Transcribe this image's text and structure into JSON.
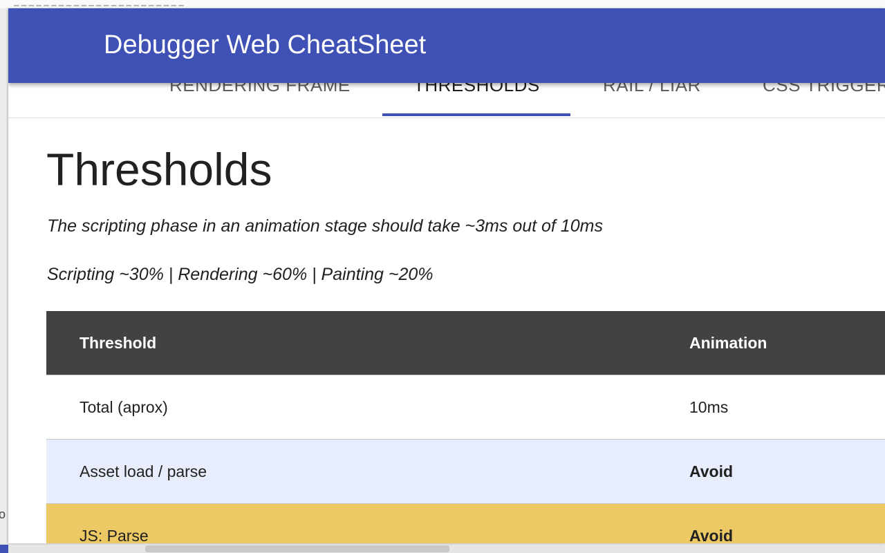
{
  "backdrop": {
    "url_fragment": "_ _ _ _ _ _ _ _ _ _ _ _ _ _ _ _ _ _ _ _ _ _ _",
    "left_edge_char": "o"
  },
  "header": {
    "title": "Debugger Web CheatSheet",
    "background": "#3f51b5"
  },
  "tabs": [
    {
      "label": "RENDERING FRAME",
      "active": false
    },
    {
      "label": "THRESHOLDS",
      "active": true
    },
    {
      "label": "RAIL / LIAR",
      "active": false
    },
    {
      "label": "CSS TRIGGER",
      "active": false
    }
  ],
  "page": {
    "title": "Thresholds",
    "intro": "The scripting phase in an animation stage should take ~3ms out of 10ms",
    "split": "Scripting ~30% | Rendering ~60% | Painting ~20%"
  },
  "table": {
    "columns": [
      "Threshold",
      "Animation"
    ],
    "rows": [
      {
        "threshold": "Total (aprox)",
        "animation": "10ms"
      },
      {
        "threshold": "Asset load / parse",
        "animation": "Avoid"
      },
      {
        "threshold": "JS: Parse",
        "animation": "Avoid"
      }
    ]
  },
  "colors": {
    "accent": "#3f51b5",
    "table_header": "#424242",
    "row_highlight_blue": "#e8edfd",
    "row_highlight_yellow": "#ecc965",
    "avoid_text": "#8b0000"
  }
}
